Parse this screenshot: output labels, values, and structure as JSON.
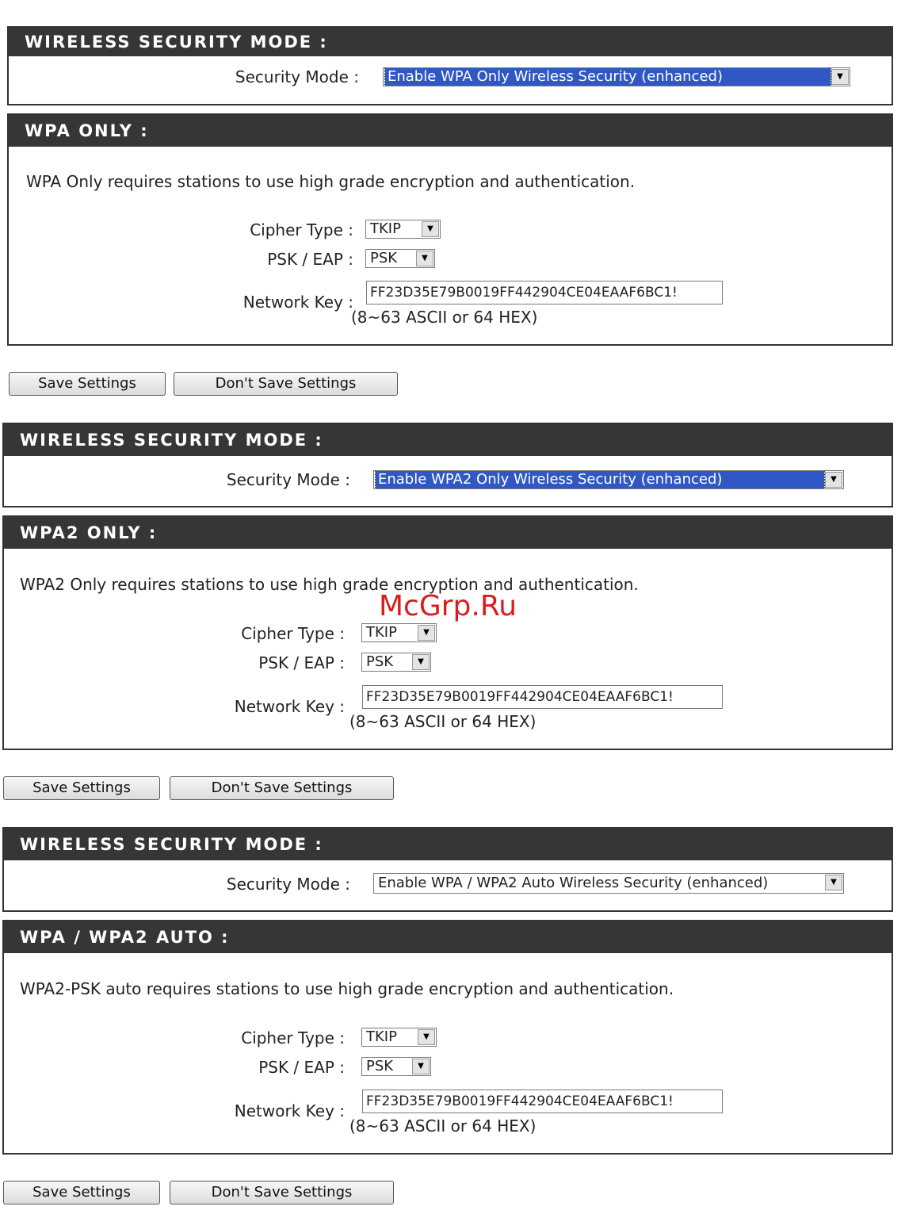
{
  "sections": [
    {
      "mode_header": "WIRELESS SECURITY MODE :",
      "security_mode_label": "Security Mode :",
      "security_mode_value": "Enable WPA Only Wireless Security (enhanced)",
      "settings_header": "WPA ONLY :",
      "description": "WPA Only requires stations to use high grade encryption and authentication.",
      "cipher_label": "Cipher Type :",
      "cipher_value": "TKIP",
      "psk_label": "PSK / EAP :",
      "psk_value": "PSK",
      "network_key_label": "Network Key :",
      "network_key_value": "FF23D35E79B0019FF442904CE04EAAF6BC1!",
      "network_key_hint": "(8~63 ASCII or 64 HEX)",
      "save_label": "Save Settings",
      "dont_save_label": "Don't Save Settings"
    },
    {
      "mode_header": "WIRELESS SECURITY MODE :",
      "security_mode_label": "Security Mode :",
      "security_mode_value": "Enable WPA2 Only Wireless Security (enhanced)",
      "settings_header": "WPA2 ONLY :",
      "description": "WPA2 Only requires stations to use high grade encryption and authentication.",
      "cipher_label": "Cipher Type :",
      "cipher_value": "TKIP",
      "psk_label": "PSK / EAP :",
      "psk_value": "PSK",
      "network_key_label": "Network Key :",
      "network_key_value": "FF23D35E79B0019FF442904CE04EAAF6BC1!",
      "network_key_hint": "(8~63 ASCII or 64 HEX)",
      "save_label": "Save Settings",
      "dont_save_label": "Don't Save Settings"
    },
    {
      "mode_header": "WIRELESS SECURITY MODE :",
      "security_mode_label": "Security Mode :",
      "security_mode_value": "Enable WPA / WPA2 Auto Wireless Security (enhanced)",
      "settings_header": "WPA / WPA2 AUTO :",
      "description": "WPA2-PSK auto requires stations to use high grade encryption and authentication.",
      "cipher_label": "Cipher Type :",
      "cipher_value": "TKIP",
      "psk_label": "PSK / EAP :",
      "psk_value": "PSK",
      "network_key_label": "Network Key :",
      "network_key_value": "FF23D35E79B0019FF442904CE04EAAF6BC1!",
      "network_key_hint": "(8~63 ASCII or 64 HEX)",
      "save_label": "Save Settings",
      "dont_save_label": "Don't Save Settings"
    }
  ],
  "watermark": "McGrp.Ru",
  "colors": {
    "header_bg": "#363636",
    "selection_bg": "#2f58c4",
    "watermark": "#d81e1e"
  },
  "icons": {
    "dropdown": "chevron-down-icon"
  }
}
